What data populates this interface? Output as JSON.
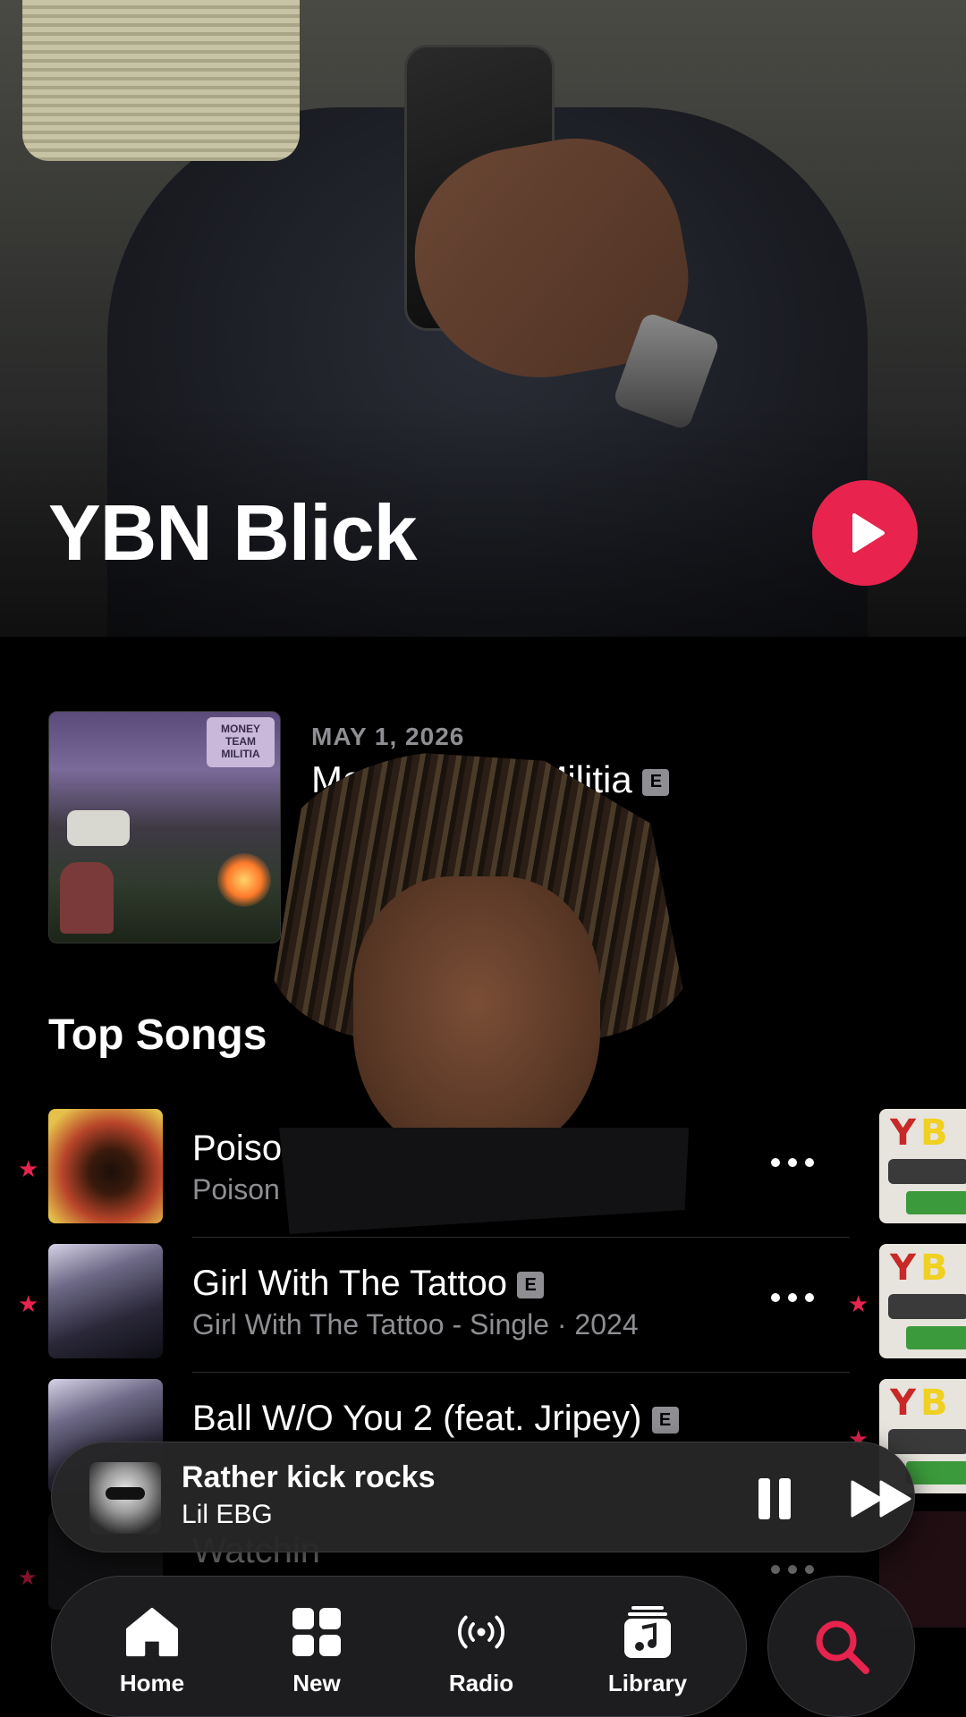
{
  "hero": {
    "artist_name": "YBN Blick",
    "play_icon": "play-icon",
    "accent_color": "#e8234e"
  },
  "latest_release": {
    "date": "MAY 1, 2026",
    "title": "Money Team Militia",
    "explicit": "E",
    "artwork_text": "MONEY TEAM MILITIA"
  },
  "top_songs": {
    "heading": "Top Songs",
    "items": [
      {
        "title": "Poiso",
        "subtitle": "Poison",
        "explicit": "",
        "starred": true
      },
      {
        "title": "Girl With The Tattoo",
        "subtitle": "Girl With The Tattoo - Single · 2024",
        "explicit": "E",
        "starred": true
      },
      {
        "title": "Ball W/O You 2 (feat. Jripey)",
        "subtitle": "",
        "explicit": "E",
        "starred": true
      },
      {
        "title": "Watchin",
        "subtitle": "",
        "explicit": "",
        "starred": true
      }
    ]
  },
  "now_playing": {
    "track": "Rather kick rocks",
    "artist": "Lil EBG",
    "pause_icon": "pause-icon",
    "forward_icon": "forward-icon"
  },
  "tab_bar": {
    "tabs": [
      {
        "label": "Home",
        "icon": "home-icon",
        "active": true
      },
      {
        "label": "New",
        "icon": "grid-icon",
        "active": false
      },
      {
        "label": "Radio",
        "icon": "radio-icon",
        "active": false
      },
      {
        "label": "Library",
        "icon": "library-icon",
        "active": false
      }
    ],
    "search_icon": "search-icon"
  }
}
